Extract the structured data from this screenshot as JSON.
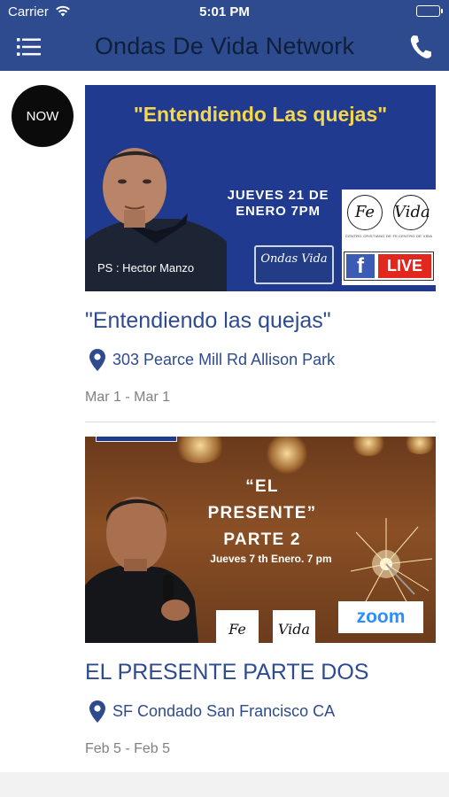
{
  "status_bar": {
    "carrier": "Carrier",
    "time": "5:01 PM",
    "battery_level": 1.0
  },
  "nav": {
    "title": "Ondas De Vida Network",
    "menu_icon": "menu-icon",
    "phone_icon": "phone-icon"
  },
  "colors": {
    "nav_bg": "#2d4b8e",
    "accent": "#2d4b8e",
    "date_text": "#808080",
    "badge_bg": "#0b0b0b"
  },
  "now_badge": "NOW",
  "events": [
    {
      "title": "\"Entendiendo las quejas\"",
      "location": "303 Pearce Mill Rd Allison Park",
      "date": "Mar 1 - Mar 1",
      "image": {
        "headline": "\"Entendiendo Las quejas\"",
        "when": "JUEVES 21 DE ENERO 7PM",
        "caption": "PS : Hector Manzo",
        "logo_text": "Ondas Vida",
        "ring_left": "Fe",
        "ring_left_caption": "CENTRO CRISTIANO DE FE",
        "ring_right": "Vida",
        "ring_right_caption": "CENTRO DE VIDA",
        "fb_letter": "f",
        "live_label": "LIVE"
      }
    },
    {
      "title": "EL PRESENTE PARTE DOS",
      "location": "SF Condado San Francisco CA",
      "date": "Feb 5 - Feb 5",
      "image": {
        "line1": "“EL",
        "line2": "PRESENTE”",
        "line3": "PARTE 2",
        "subtitle": "Jueves 7 th  Enero. 7 pm",
        "zoom_label": "zoom",
        "box_left": "Fe",
        "box_right": "Vida"
      }
    }
  ]
}
